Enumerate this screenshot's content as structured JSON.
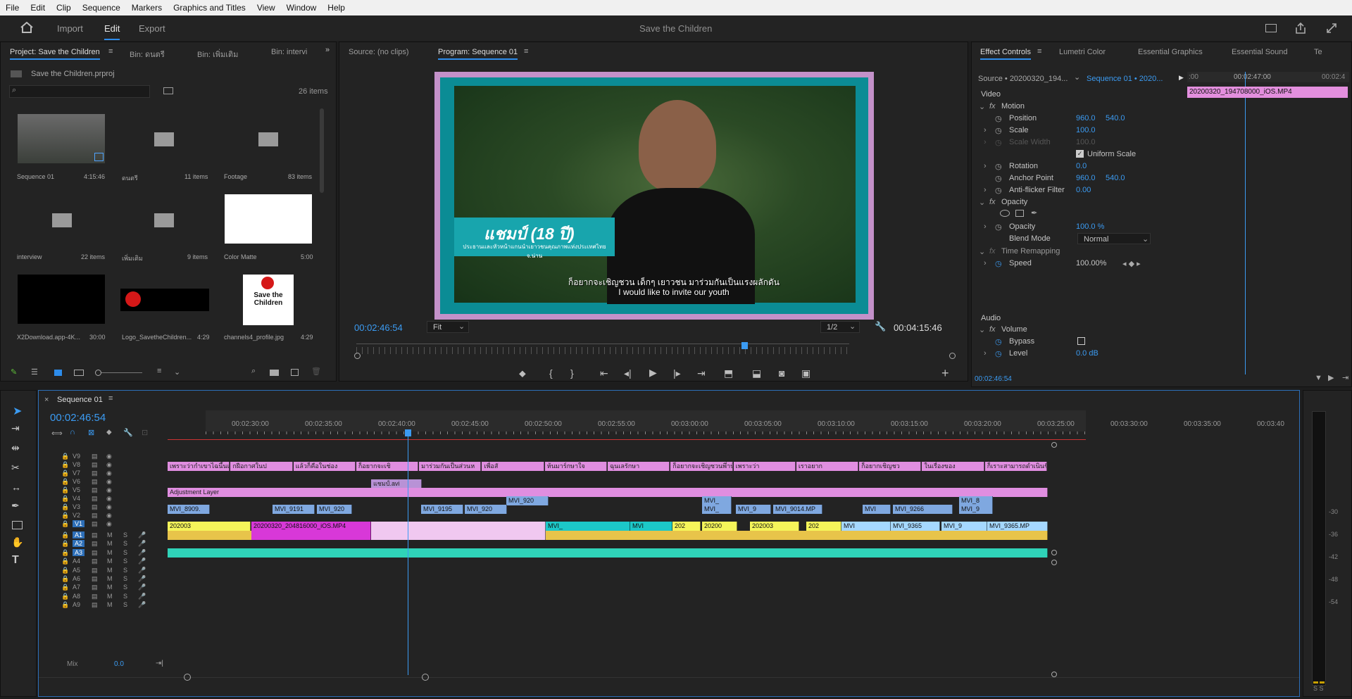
{
  "menu": [
    "File",
    "Edit",
    "Clip",
    "Sequence",
    "Markers",
    "Graphics and Titles",
    "View",
    "Window",
    "Help"
  ],
  "workspace": {
    "tabs": [
      "Import",
      "Edit",
      "Export"
    ],
    "active": "Edit",
    "title": "Save the Children"
  },
  "project": {
    "tabs": [
      "Project: Save the Children",
      "Bin: ดนตรี",
      "Bin: เพิ่มเติม",
      "Bin: intervi"
    ],
    "file": "Save the Children.prproj",
    "items_count": "26 items",
    "search_placeholder": "",
    "items": [
      {
        "name": "Sequence 01",
        "meta": "4:15:46",
        "kind": "sequence"
      },
      {
        "name": "ดนตรี",
        "meta": "11 items",
        "kind": "bin"
      },
      {
        "name": "Footage",
        "meta": "83 items",
        "kind": "bin"
      },
      {
        "name": "interview",
        "meta": "22 items",
        "kind": "bin"
      },
      {
        "name": "เพิ่มเติม",
        "meta": "9 items",
        "kind": "bin"
      },
      {
        "name": "Color Matte",
        "meta": "5:00",
        "kind": "matte"
      },
      {
        "name": "X2Download.app-4K...",
        "meta": "30:00",
        "kind": "video"
      },
      {
        "name": "Logo_SavetheChildren...",
        "meta": "4:29",
        "kind": "logo"
      },
      {
        "name": "channels4_profile.jpg",
        "meta": "4:29",
        "kind": "profile"
      }
    ],
    "logo_text": "Save the Children"
  },
  "monitor": {
    "tabs": [
      "Source: (no clips)",
      "Program: Sequence 01"
    ],
    "timecode": "00:02:46:54",
    "fit": "Fit",
    "quality": "1/2",
    "duration": "00:04:15:46",
    "lower_third_name": "แชมป์ (18 ปี)",
    "lower_third_sub": "ประธานและหัวหน้าแกนนำเยาวชนคุณภาพแห่งประเทศไทย จ.น่าน",
    "subtitle_th": "ก็อยากจะเชิญชวน เด็กๆ เยาวชน มาร่วมกันเป็นแรงผลักดัน",
    "subtitle_en": "I would like to invite our youth"
  },
  "effects": {
    "tabs": [
      "Effect Controls",
      "Lumetri Color",
      "Essential Graphics",
      "Essential Sound",
      "Te"
    ],
    "source": "Source • 20200320_194...",
    "sequence": "Sequence 01 • 2020...",
    "mini_tc": "00:02:47:00",
    "mini_tc_left": ":00",
    "mini_tc_right": "00:02:4",
    "clip_name": "20200320_194708000_iOS.MP4",
    "video_label": "Video",
    "audio_label": "Audio",
    "rows": [
      {
        "label": "Motion",
        "v1": "",
        "v2": "",
        "kind": "fx"
      },
      {
        "label": "Position",
        "v1": "960.0",
        "v2": "540.0",
        "kind": "param"
      },
      {
        "label": "Scale",
        "v1": "100.0",
        "v2": "",
        "kind": "param"
      },
      {
        "label": "Scale Width",
        "v1": "100.0",
        "v2": "",
        "kind": "disabled"
      },
      {
        "label": "Uniform Scale",
        "v1": "",
        "v2": "",
        "kind": "check"
      },
      {
        "label": "Rotation",
        "v1": "0.0",
        "v2": "",
        "kind": "param"
      },
      {
        "label": "Anchor Point",
        "v1": "960.0",
        "v2": "540.0",
        "kind": "param"
      },
      {
        "label": "Anti-flicker Filter",
        "v1": "0.00",
        "v2": "",
        "kind": "param"
      },
      {
        "label": "Opacity",
        "v1": "",
        "v2": "",
        "kind": "fx"
      },
      {
        "label": "",
        "v1": "",
        "v2": "",
        "kind": "masks"
      },
      {
        "label": "Opacity",
        "v1": "100.0 %",
        "v2": "",
        "kind": "param"
      },
      {
        "label": "Blend Mode",
        "v1": "Normal",
        "v2": "",
        "kind": "select"
      },
      {
        "label": "Time Remapping",
        "v1": "",
        "v2": "",
        "kind": "fxoff"
      },
      {
        "label": "Speed",
        "v1": "100.00%",
        "v2": "",
        "kind": "param"
      }
    ],
    "audio_rows": [
      {
        "label": "Volume",
        "v1": "",
        "kind": "fx"
      },
      {
        "label": "Bypass",
        "v1": "",
        "kind": "check"
      },
      {
        "label": "Level",
        "v1": "0.0 dB",
        "kind": "param"
      }
    ],
    "footer_tc": "00:02:46:54"
  },
  "timeline": {
    "tab": "Sequence 01",
    "timecode": "00:02:46:54",
    "ruler": [
      "00:02:30:00",
      "00:02:35:00",
      "00:02:40:00",
      "00:02:45:00",
      "00:02:50:00",
      "00:02:55:00",
      "00:03:00:00",
      "00:03:05:00",
      "00:03:10:00",
      "00:03:15:00",
      "00:03:20:00",
      "00:03:25:00",
      "00:03:30:00",
      "00:03:35:00",
      "00:03:40"
    ],
    "video_tracks": [
      "V9",
      "V8",
      "V7",
      "V6",
      "V5",
      "V4",
      "V3",
      "V2",
      "V1"
    ],
    "audio_tracks": [
      "A1",
      "A2",
      "A3",
      "A4",
      "A5",
      "A6",
      "A7",
      "A8",
      "A9"
    ],
    "mix_label": "Mix",
    "mix_value": "0.0",
    "v8_clips": [
      "เพราะว่ากำเขาไฉนึ้นแ",
      "กฝือกาศในป",
      "แล้วก็คือในช่อง",
      "ก็อยากจะเชิ",
      "มาร่วมกันเป็นส่วนห",
      "เพื่อสั",
      "ห้นมาร์กษาใจ",
      "ฉุนเลรักษา",
      "ก็อยากจะเชิญชวนพึ่าน้อง",
      "เพราะว่า",
      "เราอยาก",
      "ก็อยากเชิญชว",
      "ในเรื่องของ",
      "ก็เราะสามารถดำเนินชีวิต"
    ],
    "v6_clip": "แชมป์.avi",
    "v5_clip": "Adjustment Layer",
    "v3_clips": [
      "MVI_8909.",
      "MVI_9191",
      "MVI_920",
      "MVI_9195",
      "MVI_920",
      "MVI_",
      "MVI_9",
      "MVI_9014.MP",
      "MVI",
      "MVI_9266",
      "MVI_9"
    ],
    "v4_clips": [
      "MVI_920",
      "MVI_",
      "MVI_8"
    ],
    "v1_clips": [
      "202003",
      "20200320_204816000_iOS.MP4",
      "MVI_",
      "MVI",
      "202",
      "20200",
      "202003",
      "202",
      "MVI",
      "MVI_9365",
      "MVI_9",
      "MVI_9365.MP"
    ],
    "meter_labels": [
      "-30",
      "-36",
      "-42",
      "-48",
      "-54"
    ],
    "meter_ss": "S S"
  }
}
